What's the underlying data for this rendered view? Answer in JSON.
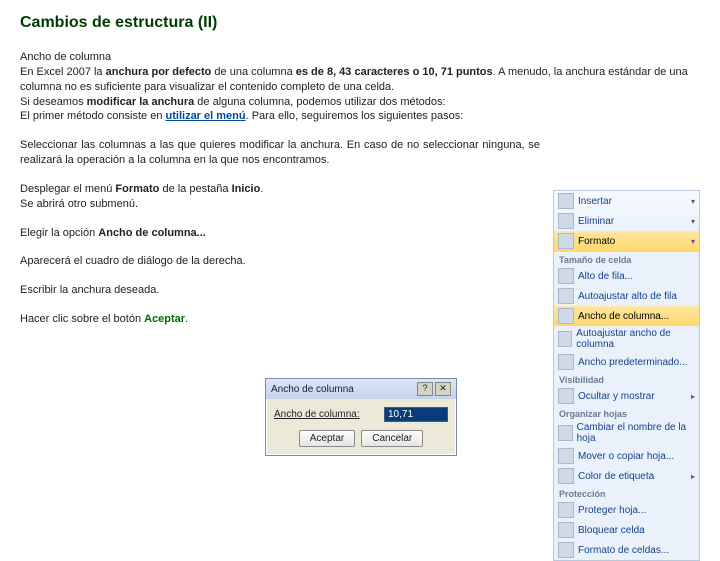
{
  "title": "Cambios de estructura (II)",
  "p1": {
    "a": "Ancho de columna",
    "b": "En Excel 2007 la ",
    "c": "anchura por defecto",
    "d": " de una columna ",
    "e": "es de 8, 43 caracteres o 10, 71 puntos",
    "f": ". A menudo, la anchura estándar de una columna no es suficiente para visualizar el contenido completo de una celda.",
    "g": "Si deseamos ",
    "h": "modificar la anchura",
    "i": " de alguna columna, podemos utilizar dos métodos:",
    "j": " El primer método consiste en ",
    "k": "utilizar el menú",
    "l": ". Para ello, seguiremos los siguientes pasos:"
  },
  "p2": "Seleccionar las columnas a las que quieres modificar la anchura. En caso de no seleccionar ninguna, se realizará la operación a la columna en la que nos encontramos.",
  "p3": {
    "a": "Desplegar el menú ",
    "b": "Formato",
    "c": " de la pestaña ",
    "d": "Inicio",
    "e": ".",
    "f": "Se abrirá otro submenú."
  },
  "p4": {
    "a": "Elegir la opción ",
    "b": "Ancho de columna..."
  },
  "p5": "Aparecerá el cuadro de diálogo de la derecha.",
  "p6": "Escribir la anchura deseada.",
  "p7": {
    "a": "Hacer clic sobre el botón ",
    "b": "Aceptar",
    "c": "."
  },
  "menu": {
    "top": [
      {
        "t": "Insertar",
        "a": "▾"
      },
      {
        "t": "Eliminar",
        "a": "▾"
      },
      {
        "t": "Formato",
        "a": "▾",
        "hl": true
      }
    ],
    "g1": "Tamaño de celda",
    "g1items": [
      "Alto de fila...",
      "Autoajustar alto de fila",
      "Ancho de columna...",
      "Autoajustar ancho de columna",
      "Ancho predeterminado..."
    ],
    "g1hl": 2,
    "g2": "Visibilidad",
    "g2items": [
      {
        "t": "Ocultar y mostrar",
        "a": "▸"
      }
    ],
    "g3": "Organizar hojas",
    "g3items": [
      "Cambiar el nombre de la hoja",
      "Mover o copiar hoja...",
      {
        "t": "Color de etiqueta",
        "a": "▸"
      }
    ],
    "g4": "Protección",
    "g4items": [
      {
        "t": "Proteger hoja..."
      },
      {
        "t": "Bloquear celda"
      },
      {
        "t": "Formato de celdas..."
      }
    ]
  },
  "dlg": {
    "title": "Ancho de columna",
    "help": "?",
    "close": "✕",
    "label": "Ancho de columna:",
    "value": "10,71",
    "ok": "Aceptar",
    "cancel": "Cancelar"
  }
}
